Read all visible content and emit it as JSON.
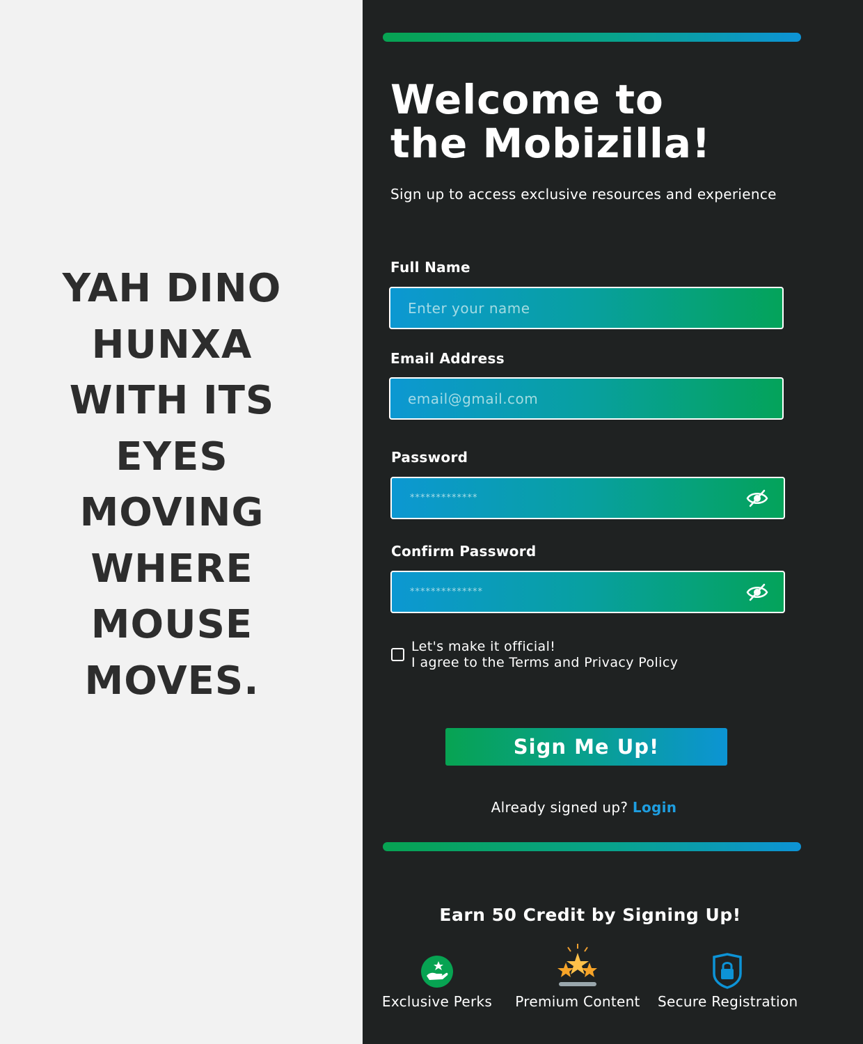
{
  "left": {
    "tagline_lines": [
      "YAH DINO",
      "HUNXA",
      "WITH ITS",
      "EYES",
      "MOVING",
      "WHERE",
      "MOUSE",
      "MOVES."
    ]
  },
  "form": {
    "title_lines": [
      "Welcome to",
      "the Mobizilla!"
    ],
    "subtitle": "Sign up to access exclusive resources and experience",
    "full_name": {
      "label": "Full Name",
      "placeholder": "Enter your name",
      "value": ""
    },
    "email": {
      "label": "Email Address",
      "placeholder": "email@gmail.com",
      "value": ""
    },
    "password": {
      "label": "Password",
      "masked": "*************"
    },
    "confirm_password": {
      "label": "Confirm Password",
      "masked": "**************"
    },
    "terms": {
      "line1": "Let's make it official!",
      "line2": "I agree to the Terms and Privacy Policy",
      "checked": false
    },
    "submit_label": "Sign Me Up!",
    "already_text": "Already signed up?",
    "login_label": "Login"
  },
  "promo": {
    "title": "Earn 50 Credit by Signing Up!",
    "features": [
      {
        "icon": "hand-star-icon",
        "label": "Exclusive Perks"
      },
      {
        "icon": "stars-icon",
        "label": "Premium Content"
      },
      {
        "icon": "shield-lock-icon",
        "label": "Secure Registration"
      }
    ]
  },
  "colors": {
    "panel_bg": "#1f2222",
    "left_bg": "#f2f2f2",
    "accent_green": "#07a352",
    "accent_blue": "#0d93d6",
    "login_link": "#1e9ee0"
  }
}
